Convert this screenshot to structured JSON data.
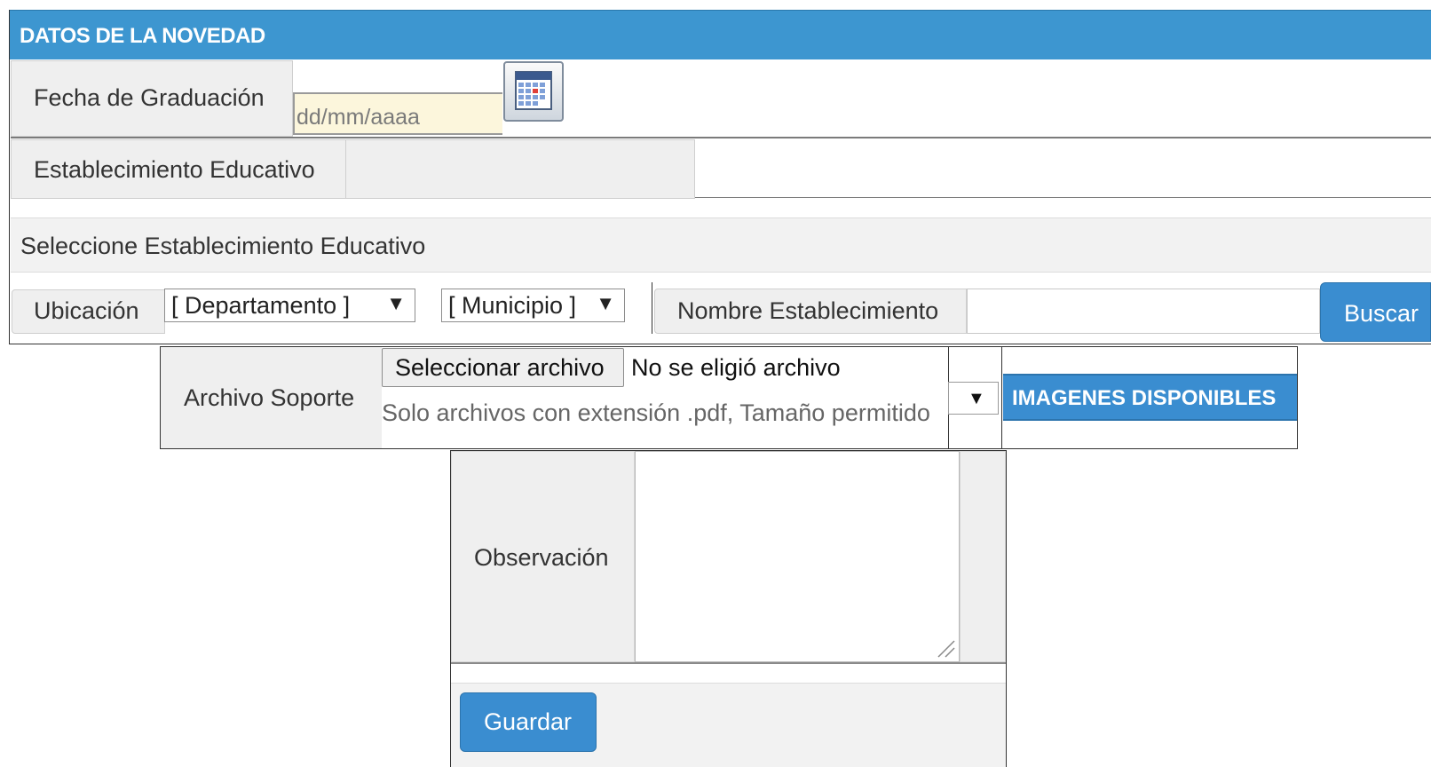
{
  "section": {
    "title": "DATOS DE LA NOVEDAD",
    "accent_color": "#3d96d0"
  },
  "fecha": {
    "label": "Fecha de Graduación",
    "placeholder": "dd/mm/aaaa",
    "calendar_icon": "calendar-icon"
  },
  "establecimiento": {
    "label": "Establecimiento Educativo",
    "value": ""
  },
  "seleccion": {
    "heading": "Seleccione Establecimiento Educativo",
    "ubicacion_label": "Ubicación",
    "departamento": "[ Departamento ]",
    "municipio": "[ Municipio ]",
    "dropdown_arrow": "▼",
    "nombre_label": "Nombre Establecimiento",
    "nombre_value": "",
    "buscar_label": "Buscar"
  },
  "archivo": {
    "label": "Archivo Soporte",
    "button_label": "Seleccionar archivo",
    "status": "No se eligió archivo",
    "hint": "Solo archivos con extensión .pdf, Tamaño permitido",
    "dropdown_arrow": "▼",
    "imagenes_label": "IMAGENES DISPONIBLES"
  },
  "observacion": {
    "label": "Observación",
    "value": "",
    "guardar_label": "Guardar"
  }
}
